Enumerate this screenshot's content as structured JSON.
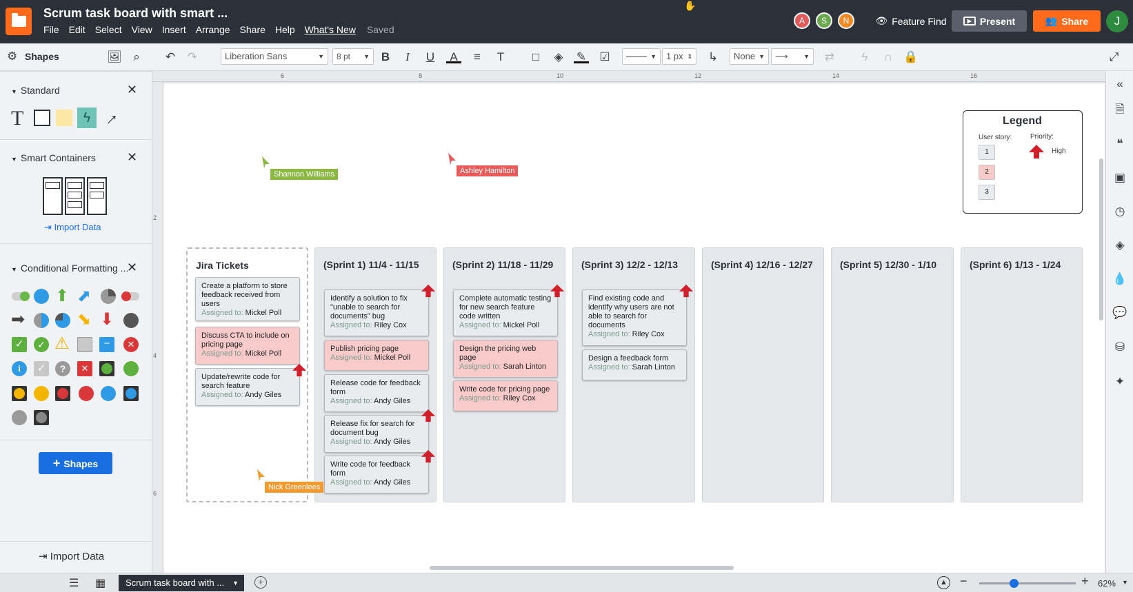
{
  "app": {
    "doc_title": "Scrum task board with smart ...",
    "menu": [
      "File",
      "Edit",
      "Select",
      "View",
      "Insert",
      "Arrange",
      "Share",
      "Help",
      "What's New"
    ],
    "saved_status": "Saved",
    "collaborators": [
      {
        "initial": "A",
        "color": "#e05c5c"
      },
      {
        "initial": "S",
        "color": "#6ba84f"
      },
      {
        "initial": "N",
        "color": "#f08a24"
      }
    ],
    "feature_find_label": "Feature Find",
    "present_label": "Present",
    "share_label": "Share",
    "user_initial": "J"
  },
  "toolbar": {
    "font_family": "Liberation Sans",
    "font_size": "8 pt",
    "line_width": "1 px",
    "arrow_start": "None"
  },
  "sidebar": {
    "title": "Shapes",
    "standard_label": "Standard",
    "smart_containers_label": "Smart Containers",
    "import_data_label": "Import Data",
    "conditional_formatting_label": "Conditional Formatting ...",
    "add_shapes_label": "Shapes",
    "bottom_import_label": "Import Data"
  },
  "rulers": {
    "top": [
      "6",
      "8",
      "10",
      "12",
      "14",
      "16"
    ],
    "left": [
      "2",
      "4",
      "6"
    ]
  },
  "board": {
    "legend": {
      "title": "Legend",
      "user_story_label": "User story:",
      "priority_label": "Priority:",
      "story_numbers": [
        "1",
        "2",
        "3"
      ],
      "high_label": "High"
    },
    "assigned_prefix": "Assigned to:",
    "columns": [
      {
        "title": "Jira Tickets",
        "cards": [
          {
            "text": "Create a platform to store feedback received from users",
            "assignee": "Mickel Poll"
          },
          {
            "text": "Discuss CTA to include on pricing page",
            "assignee": "Mickel Poll"
          },
          {
            "text": "Update/rewrite code for search feature",
            "assignee": "Andy Giles"
          }
        ]
      },
      {
        "title": "(Sprint 1)  11/4 - 11/15",
        "cards": [
          {
            "text": "Identify a solution to fix \"unable to search for documents\" bug",
            "assignee": "Riley Cox"
          },
          {
            "text": "Publish pricing page",
            "assignee": "Mickel Poll"
          },
          {
            "text": "Release code for feedback form",
            "assignee": "Andy Giles"
          },
          {
            "text": "Release fix for search for document bug",
            "assignee": "Andy Giles"
          },
          {
            "text": "Write code for feedback form",
            "assignee": "Andy Giles"
          }
        ]
      },
      {
        "title": "(Sprint 2)  11/18 - 11/29",
        "cards": [
          {
            "text": "Complete automatic testing for new search feature code written",
            "assignee": "Mickel Poll"
          },
          {
            "text": "Design the pricing web page",
            "assignee": "Sarah Linton"
          },
          {
            "text": "Write code for pricing page",
            "assignee": "Riley Cox"
          }
        ]
      },
      {
        "title": "(Sprint 3)  12/2 - 12/13",
        "cards": [
          {
            "text": "Find existing code and identify why users are not able to search for documents",
            "assignee": "Riley Cox"
          },
          {
            "text": "Design a feedback form",
            "assignee": "Sarah Linton"
          }
        ]
      },
      {
        "title": "(Sprint 4)  12/16 - 12/27"
      },
      {
        "title": "(Sprint 5)  12/30 - 1/10"
      },
      {
        "title": "(Sprint 6)  1/13 - 1/24"
      }
    ],
    "cursors": [
      {
        "name": "Shannon Williams",
        "color": "#8ab843"
      },
      {
        "name": "Ashley Hamilton",
        "color": "#e85b5b"
      },
      {
        "name": "Nick Greenlees",
        "color": "#f39a2e"
      }
    ]
  },
  "bottom": {
    "page_tab": "Scrum task board with ...",
    "zoom": "62%"
  }
}
